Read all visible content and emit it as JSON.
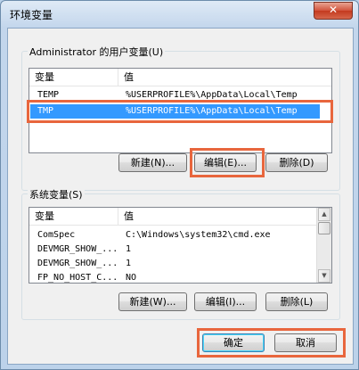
{
  "window": {
    "title": "环境变量",
    "close_glyph": "✕"
  },
  "user_vars": {
    "group_label": "Administrator 的用户变量(U)",
    "col_var": "变量",
    "col_val": "值",
    "rows": [
      {
        "name": "TEMP",
        "value": "%USERPROFILE%\\AppData\\Local\\Temp"
      },
      {
        "name": "TMP",
        "value": "%USERPROFILE%\\AppData\\Local\\Temp"
      }
    ],
    "new_btn": "新建(N)...",
    "edit_btn": "编辑(E)...",
    "delete_btn": "删除(D)"
  },
  "system_vars": {
    "group_label": "系统变量(S)",
    "col_var": "变量",
    "col_val": "值",
    "rows": [
      {
        "name": "ComSpec",
        "value": "C:\\Windows\\system32\\cmd.exe"
      },
      {
        "name": "DEVMGR_SHOW_...",
        "value": "1"
      },
      {
        "name": "DEVMGR_SHOW_...",
        "value": "1"
      },
      {
        "name": "FP_NO_HOST_C...",
        "value": "NO"
      }
    ],
    "new_btn": "新建(W)...",
    "edit_btn": "编辑(I)...",
    "delete_btn": "删除(L)"
  },
  "footer": {
    "ok_btn": "确定",
    "cancel_btn": "取消"
  },
  "colors": {
    "highlight": "#e8663d",
    "selection": "#3399ff"
  }
}
